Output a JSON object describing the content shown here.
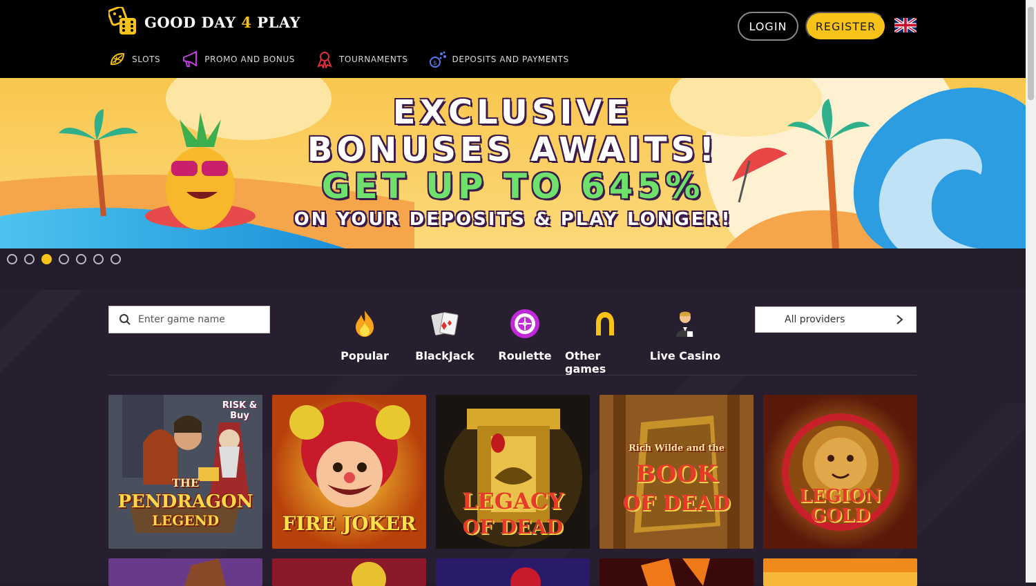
{
  "header": {
    "logo_pre": "GOOD DAY ",
    "logo_four": "4",
    "logo_post": " PLAY",
    "login_label": "LOGIN",
    "register_label": "REGISTER",
    "language_icon": "uk-flag-icon"
  },
  "nav": {
    "items": [
      {
        "label": "SLOTS",
        "icon": "lemon-icon"
      },
      {
        "label": "PROMO AND BONUS",
        "icon": "megaphone-icon"
      },
      {
        "label": "TOURNAMENTS",
        "icon": "ribbon-icon"
      },
      {
        "label": "DEPOSITS AND PAYMENTS",
        "icon": "coins-icon"
      }
    ]
  },
  "banner": {
    "line1": "EXCLUSIVE",
    "line2": "BONUSES AWAITS!",
    "line3": "GET UP TO 645%",
    "line4": "ON YOUR DEPOSITS & PLAY LONGER!"
  },
  "slider": {
    "active_index": 2
  },
  "search": {
    "placeholder": "Enter game name"
  },
  "categories": [
    {
      "label": "Popular",
      "icon": "fire-icon"
    },
    {
      "label": "BlackJack",
      "icon": "cards-icon"
    },
    {
      "label": "Roulette",
      "icon": "roulette-icon"
    },
    {
      "label": "Other games",
      "icon": "horseshoe-icon"
    },
    {
      "label": "Live Casino",
      "icon": "dealer-icon"
    }
  ],
  "providers": {
    "label": "All providers"
  },
  "games": [
    {
      "title1": "THE",
      "title2": "PENDRAGON",
      "title3": "LEGEND",
      "badge": "RISK & Buy"
    },
    {
      "title1": "",
      "title2": "FIRE JOKER",
      "title3": ""
    },
    {
      "title1": "",
      "title2": "LEGACY",
      "title3": "OF DEAD"
    },
    {
      "title1": "Rich Wilde and the",
      "title2": "BOOK",
      "title3": "OF DEAD"
    },
    {
      "title1": "",
      "title2": "LEGION",
      "title3": "GOLD"
    }
  ],
  "colors": {
    "accent": "#f7c318",
    "header_bg": "#000000",
    "page_bg": "#271f2f"
  }
}
